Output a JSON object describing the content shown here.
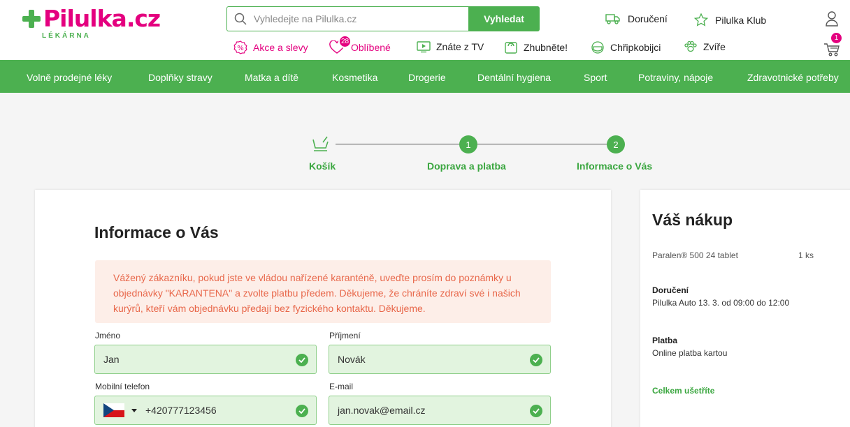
{
  "brand": {
    "name": "Pilulka.cz",
    "sub": "LÉKÁRNA"
  },
  "search": {
    "placeholder": "Vyhledejte na Pilulka.cz",
    "button": "Vyhledat"
  },
  "top_links": {
    "delivery": "Doručení",
    "club": "Pilulka Klub"
  },
  "sub_links": {
    "sales": "Akce a slevy",
    "favorites": "Oblíbené",
    "favorites_count": "28",
    "tv": "Znáte z TV",
    "diet": "Zhubněte!",
    "flu": "Chřipkobijci",
    "animals": "Zvíře"
  },
  "cart": {
    "count": "1"
  },
  "categories": [
    "Volně prodejné léky",
    "Doplňky stravy",
    "Matka a dítě",
    "Kosmetika",
    "Drogerie",
    "Dentální hygiena",
    "Sport",
    "Potraviny, nápoje",
    "Zdravotnické potřeby"
  ],
  "steps": [
    {
      "label": "Košík",
      "number": ""
    },
    {
      "label": "Doprava a platba",
      "number": "1"
    },
    {
      "label": "Informace o Vás",
      "number": "2"
    }
  ],
  "form": {
    "title": "Informace o Vás",
    "notice": "Vážený zákazníku, pokud jste ve vládou nařízené karanténě, uveďte prosím do poznámky u objednávky \"KARANTENA\" a zvolte platbu předem. Děkujeme, že chráníte zdraví své i našich kurýrů, kteří vám objednávku předají bez fyzického kontaktu. Děkujeme.",
    "first_name_label": "Jméno",
    "first_name": "Jan",
    "last_name_label": "Příjmení",
    "last_name": "Novák",
    "phone_label": "Mobilní telefon",
    "phone": "+420777123456",
    "email_label": "E-mail",
    "email": "jan.novak@email.cz"
  },
  "summary": {
    "title": "Váš nákup",
    "item": "Paralen® 500 24 tablet",
    "qty": "1 ks",
    "delivery_h": "Doručení",
    "delivery_v": "Pilulka Auto 13. 3. od 09:00 do 12:00",
    "payment_h": "Platba",
    "payment_v": "Online platba kartou",
    "savings": "Celkem ušetříte"
  },
  "colors": {
    "green": "#4cb050",
    "pink": "#e4007f",
    "notice_bg": "#fdeee8",
    "notice_text": "#e8674a"
  }
}
